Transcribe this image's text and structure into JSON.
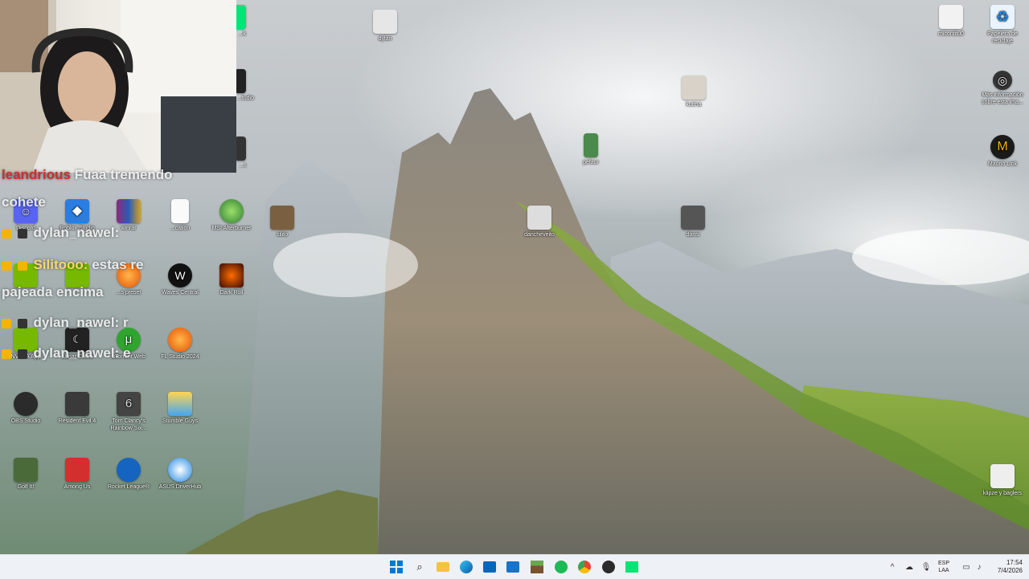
{
  "chat": {
    "lines": [
      {
        "user": "leandrious",
        "text": "Fuaa tremendo"
      },
      {
        "user": "",
        "text": "cohete"
      },
      {
        "user": "dylan_nawel:",
        "text": ""
      },
      {
        "user": "Silitooo:",
        "text": "estas re"
      },
      {
        "user": "",
        "text": "pajeada encima"
      },
      {
        "user": "dylan_nawel:",
        "text": "r"
      },
      {
        "user": "dylan_nawel:",
        "text": "e"
      }
    ]
  },
  "desktop_icons": {
    "dylan": "dylan",
    "kutma": "kutma",
    "pefaur": "pefaur",
    "silito": "silito",
    "dancheveito": "dancheveito",
    "dansi": "dansi",
    "micontitu": "micontitu0",
    "recycle": "Papelera de reciclaje",
    "mas_info": "Más información sobre esta ima...",
    "maono": "Maono Link",
    "klipze": "klipze y baglers",
    "discord": "Discord",
    "roblox": "Roblox Studio",
    "winrar": "winrar",
    "text_doc": "...cation",
    "msi": "MSI Afterburner",
    "nvidia2": "",
    "nvidia3": "",
    "fl_preset": "...s preset",
    "waves": "Waves Central",
    "dark_roll": "Dark Roll",
    "nvidia_app": "NVIDIA App",
    "lunar": "Lunar Client",
    "utorrent": "uTorrent Web",
    "fl_studio": "FL Studio 2024",
    "obs": "OBS Studio",
    "re4": "Resident Evil 4",
    "r6": "Tom Clancy's Rainbow Six...",
    "stumble": "Stumble Guys",
    "golf": "Golf It!",
    "among": "Among Us",
    "rocket": "Rocket League®",
    "asus": "ASUS DriverHub",
    "top_left_a": "...k",
    "top_left_b": "...tudio",
    "top_left_c": "...t"
  },
  "taskbar": {
    "lang_top": "ESP",
    "lang_bottom": "LAA",
    "time": "17:54",
    "date": "7/4/2026"
  },
  "icons": {
    "start": "windows-start-icon",
    "search": "search-icon",
    "explorer": "file-explorer-icon",
    "edge": "edge-icon",
    "store": "store-icon",
    "outlook": "outlook-icon",
    "minecraft": "minecraft-icon",
    "spotify": "spotify-icon",
    "chrome": "chrome-icon",
    "obs": "obs-icon",
    "green": "green-app-icon"
  },
  "colors": {
    "taskbar_bg": "#eef1f5",
    "chat_username": "#c9302c",
    "accent_blue": "#0067c0"
  }
}
